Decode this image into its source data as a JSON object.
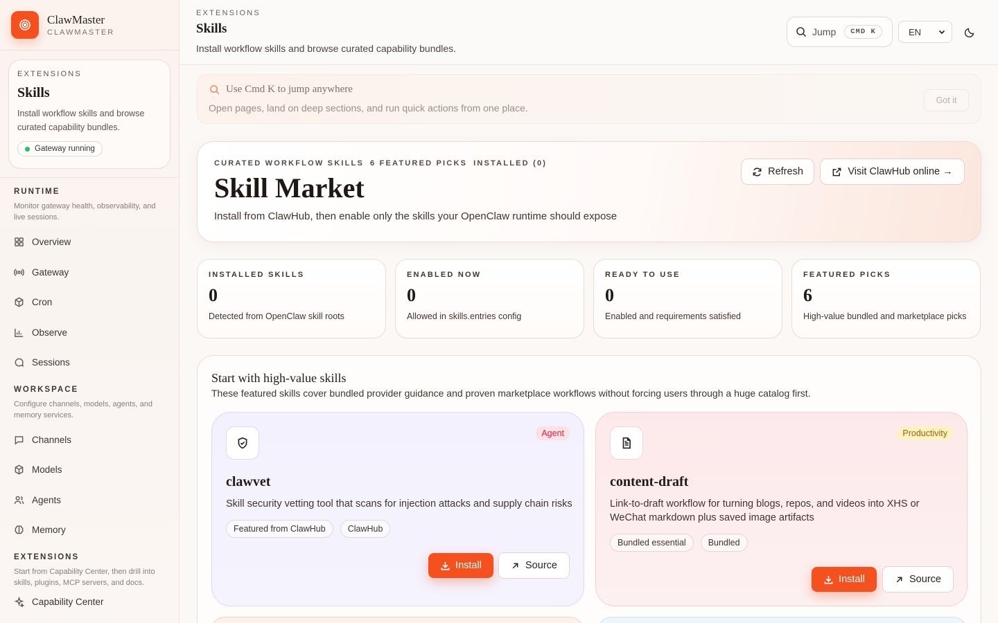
{
  "brand": {
    "name": "ClawMaster",
    "subtitle": "CLAWMASTER",
    "accent": "#f4511e"
  },
  "sidebar": {
    "context_card": {
      "eyebrow": "EXTENSIONS",
      "title": "Skills",
      "description": "Install workflow skills and browse curated capability bundles.",
      "status": "Gateway running",
      "status_color": "#22c55e"
    },
    "sections": [
      {
        "title": "RUNTIME",
        "description": "Monitor gateway health, observability, and live sessions.",
        "items": [
          {
            "label": "Overview",
            "icon": "grid-icon"
          },
          {
            "label": "Gateway",
            "icon": "broadcast-icon"
          },
          {
            "label": "Cron",
            "icon": "cube-icon"
          },
          {
            "label": "Observe",
            "icon": "bar-chart-icon"
          },
          {
            "label": "Sessions",
            "icon": "chat-bubble-icon"
          }
        ]
      },
      {
        "title": "WORKSPACE",
        "description": "Configure channels, models, agents, and memory services.",
        "items": [
          {
            "label": "Channels",
            "icon": "message-square-icon"
          },
          {
            "label": "Models",
            "icon": "cube-icon"
          },
          {
            "label": "Agents",
            "icon": "users-icon"
          },
          {
            "label": "Memory",
            "icon": "brain-icon"
          }
        ]
      },
      {
        "title": "EXTENSIONS",
        "description": "Start from Capability Center, then drill into skills, plugins, MCP servers, and docs.",
        "items": [
          {
            "label": "Capability Center",
            "icon": "sparkle-icon"
          }
        ]
      }
    ]
  },
  "header": {
    "eyebrow": "EXTENSIONS",
    "title": "Skills",
    "subtitle": "Install workflow skills and browse curated capability bundles.",
    "jump_label": "Jump",
    "jump_shortcut": "CMD K",
    "language": "EN"
  },
  "tip": {
    "title": "Use Cmd K to jump anywhere",
    "description": "Open pages, land on deep sections, and run quick actions from one place.",
    "dismiss": "Got it"
  },
  "hero": {
    "tags": [
      "CURATED WORKFLOW SKILLS",
      "6 FEATURED PICKS",
      "INSTALLED (0)"
    ],
    "title": "Skill Market",
    "description": "Install from ClawHub, then enable only the skills your OpenClaw runtime should expose",
    "refresh_label": "Refresh",
    "visit_label": "Visit ClawHub online →"
  },
  "stats": [
    {
      "label": "INSTALLED SKILLS",
      "value": "0",
      "description": "Detected from OpenClaw skill roots"
    },
    {
      "label": "ENABLED NOW",
      "value": "0",
      "description": "Allowed in skills.entries config"
    },
    {
      "label": "READY TO USE",
      "value": "0",
      "description": "Enabled and requirements satisfied"
    },
    {
      "label": "FEATURED PICKS",
      "value": "6",
      "description": "High-value bundled and marketplace picks"
    }
  ],
  "featured": {
    "title": "Start with high-value skills",
    "description": "These featured skills cover bundled provider guidance and proven marketplace workflows without forcing users through a huge catalog first.",
    "cards": [
      {
        "name": "clawvet",
        "icon": "shield-check-icon",
        "badge": "Agent",
        "badge_color": "#e11d48",
        "description": "Skill security vetting tool that scans for injection attacks and supply chain risks",
        "chips": [
          "Featured from ClawHub",
          "ClawHub"
        ],
        "install_label": "Install",
        "source_label": "Source"
      },
      {
        "name": "content-draft",
        "icon": "document-icon",
        "badge": "Productivity",
        "badge_color": "#a16207",
        "description": "Link-to-draft workflow for turning blogs, repos, and videos into XHS or WeChat markdown plus saved image artifacts",
        "chips": [
          "Bundled essential",
          "Bundled"
        ],
        "install_label": "Install",
        "source_label": "Source"
      }
    ]
  }
}
